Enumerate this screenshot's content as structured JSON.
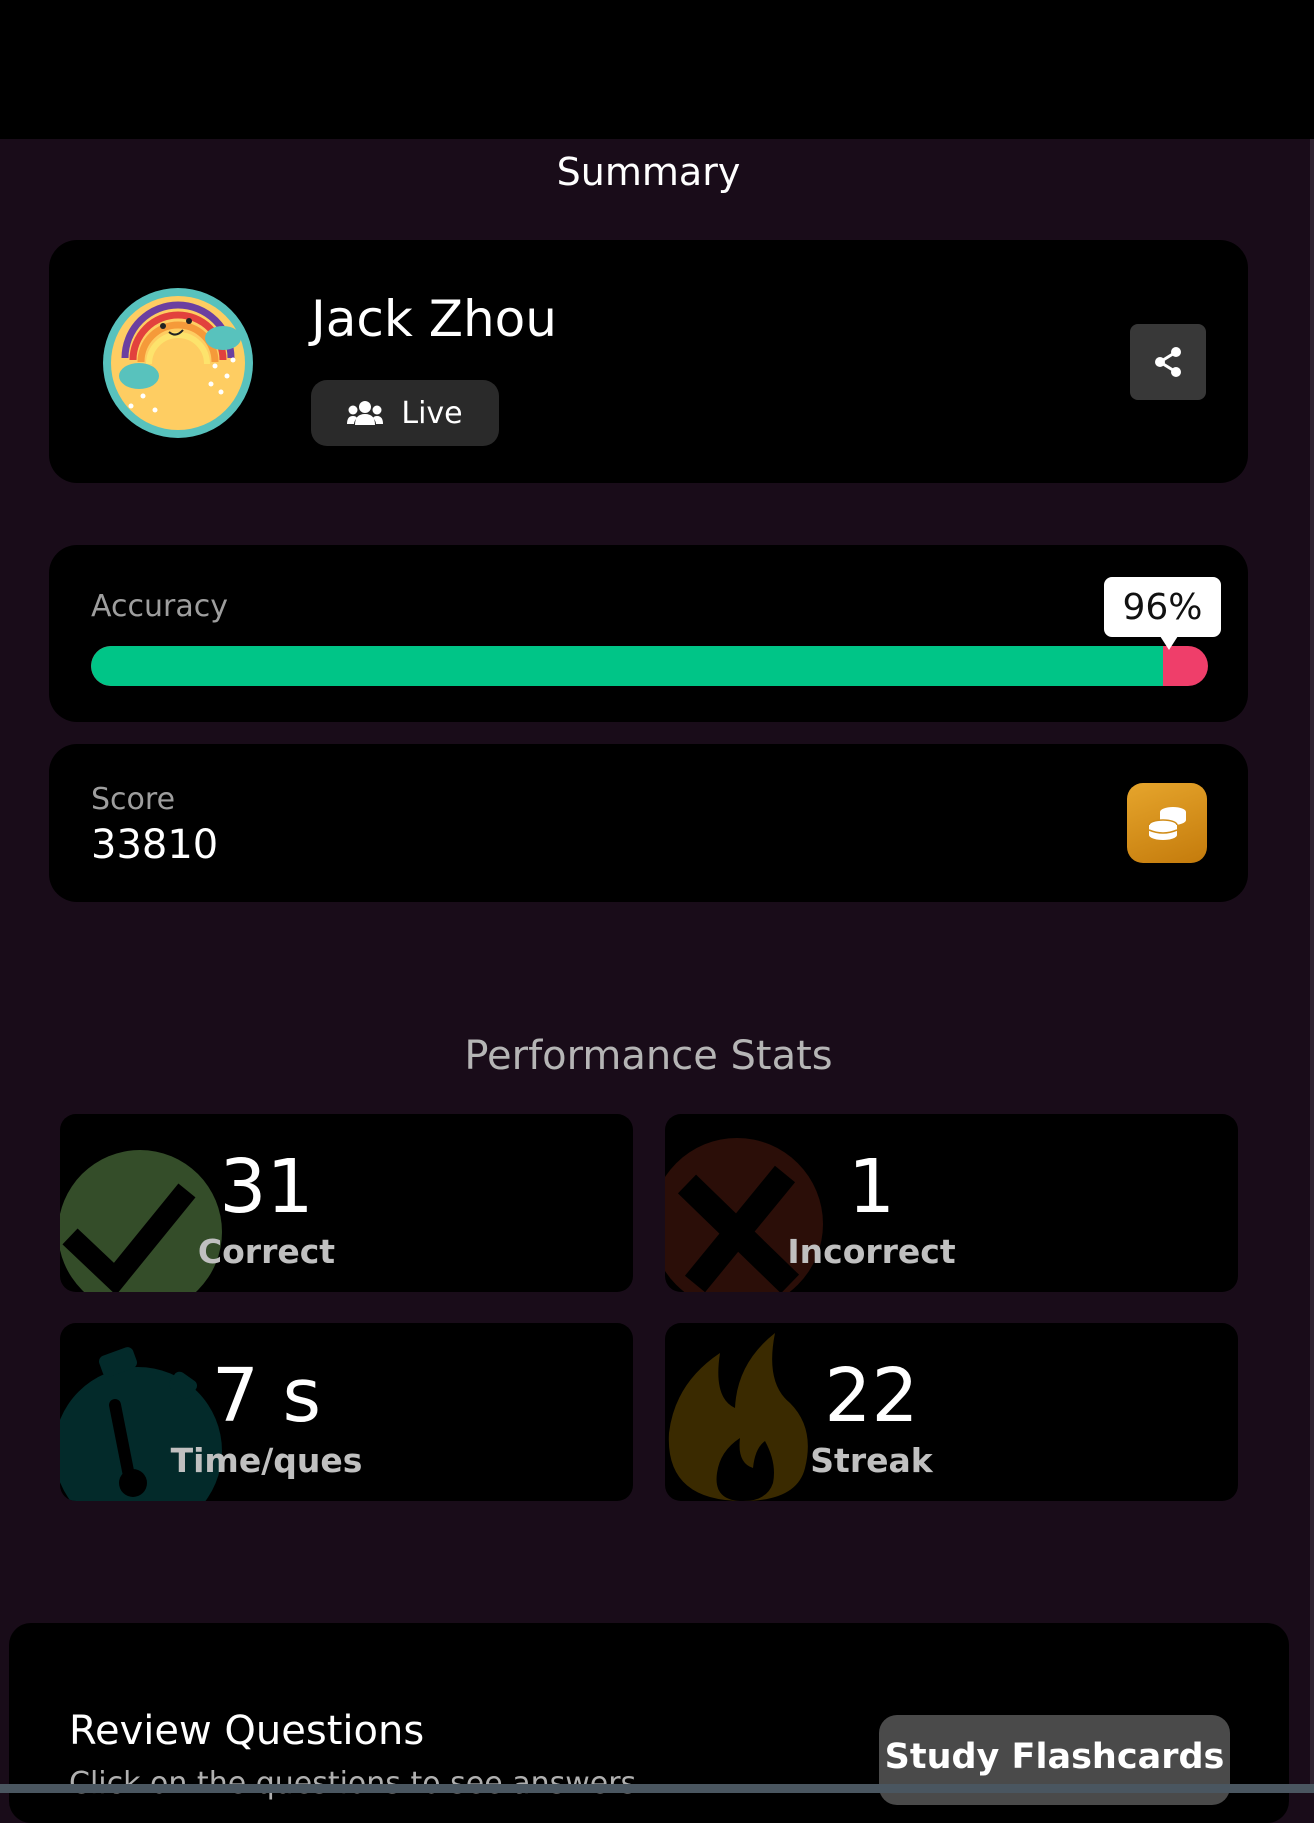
{
  "header": {
    "title": "Summary"
  },
  "profile": {
    "name": "Jack Zhou",
    "mode_label": "Live"
  },
  "accuracy": {
    "label": "Accuracy",
    "percent_label": "96%",
    "value": 0.96
  },
  "score": {
    "label": "Score",
    "value": "33810"
  },
  "performance": {
    "title": "Performance Stats",
    "correct": {
      "value": "31",
      "label": "Correct"
    },
    "incorrect": {
      "value": "1",
      "label": "Incorrect"
    },
    "time": {
      "value": "7 s",
      "label": "Time/ques"
    },
    "streak": {
      "value": "22",
      "label": "Streak"
    }
  },
  "review": {
    "title": "Review Questions",
    "subtitle": "Click on the questions to see answers",
    "flashcards_label": "Study Flashcards"
  },
  "colors": {
    "correct": "#00c587",
    "incorrect": "#ef3e6a",
    "coin": "#e6a52c"
  }
}
